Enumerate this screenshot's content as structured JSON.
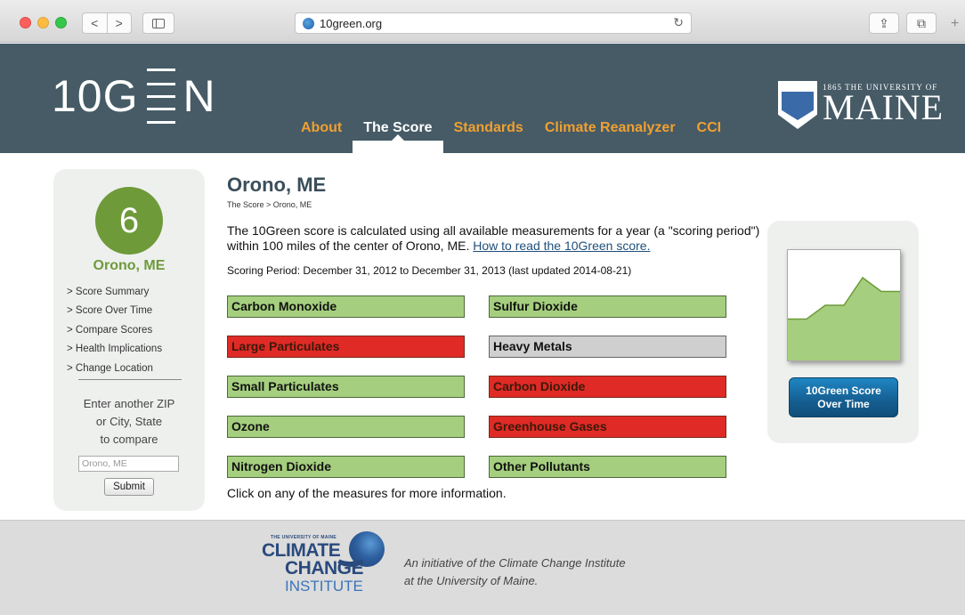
{
  "browser": {
    "url": "10green.org",
    "back_icon": "chevron-left-icon",
    "forward_icon": "chevron-right-icon",
    "back_glyph": "<",
    "forward_glyph": ">",
    "reload_glyph": "↻",
    "share_glyph": "⇪",
    "tabs_glyph": "⧉",
    "new_tab_glyph": "+"
  },
  "header": {
    "logo_text_left": "10G",
    "logo_text_right": "N",
    "nav": [
      {
        "label": "About"
      },
      {
        "label": "The Score",
        "active": true
      },
      {
        "label": "Standards"
      },
      {
        "label": "Climate Reanalyzer"
      },
      {
        "label": "CCI"
      }
    ],
    "university_small": "1865 THE UNIVERSITY OF",
    "university_big": "MAINE"
  },
  "sidebar": {
    "score": "6",
    "city": "Orono, ME",
    "links": [
      "> Score Summary",
      "> Score Over Time",
      "> Compare Scores",
      "> Health Implications",
      "> Change Location"
    ],
    "compare_line1": "Enter another ZIP",
    "compare_line2": "or City, State",
    "compare_line3": "to compare",
    "input_value": "Orono, ME",
    "submit_label": "Submit"
  },
  "main": {
    "title": "Orono, ME",
    "breadcrumb": "The Score > Orono, ME",
    "intro_text": "The 10Green score is calculated using all available measurements for a year (a \"scoring period\") within 100 miles of the center of Orono, ME. ",
    "intro_link": "How to read the 10Green score.",
    "scoring_period": "Scoring Period: December 31, 2012 to December 31, 2013 (last updated 2014-08-21)",
    "measures_left": [
      {
        "label": "Carbon Monoxide",
        "status": "good"
      },
      {
        "label": "Large Particulates",
        "status": "bad"
      },
      {
        "label": "Small Particulates",
        "status": "good"
      },
      {
        "label": "Ozone",
        "status": "good"
      },
      {
        "label": "Nitrogen Dioxide",
        "status": "good"
      }
    ],
    "measures_right": [
      {
        "label": "Sulfur Dioxide",
        "status": "good"
      },
      {
        "label": "Heavy Metals",
        "status": "na"
      },
      {
        "label": "Carbon Dioxide",
        "status": "bad"
      },
      {
        "label": "Greenhouse Gases",
        "status": "bad"
      },
      {
        "label": "Other Pollutants",
        "status": "good"
      }
    ],
    "footnote": "Click on any of the measures for more information."
  },
  "chart_panel": {
    "button_line1": "10Green Score",
    "button_line2": "Over Time"
  },
  "chart_data": {
    "type": "area",
    "values": [
      5,
      5,
      6,
      6,
      8,
      7,
      7
    ],
    "ylim": [
      2,
      10
    ],
    "fill_color": "#a5cf7e",
    "line_color": "#6e9a3a"
  },
  "footer": {
    "cci_uni": "THE UNIVERSITY OF MAINE",
    "cci_climate": "CLIMATE",
    "cci_change": "CHANGE",
    "cci_institute": "INSTITUTE",
    "text_line1": "An initiative of the Climate Change Institute",
    "text_line2": "at the University of Maine."
  },
  "colors": {
    "header_bg": "#465b66",
    "nav_accent": "#f0a030",
    "good": "#a5cf7e",
    "bad": "#e02a26",
    "na": "#cfcfcf",
    "score_green": "#6e9a3a"
  }
}
